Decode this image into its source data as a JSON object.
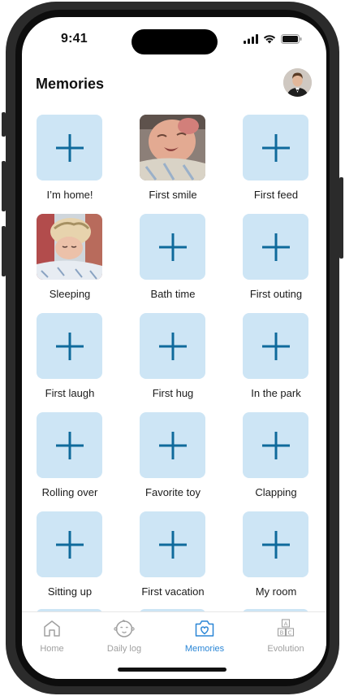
{
  "status": {
    "time": "9:41"
  },
  "header": {
    "title": "Memories"
  },
  "memories": [
    {
      "label": "I’m home!",
      "has_photo": false
    },
    {
      "label": "First smile",
      "has_photo": true
    },
    {
      "label": "First feed",
      "has_photo": false
    },
    {
      "label": "Sleeping",
      "has_photo": true
    },
    {
      "label": "Bath time",
      "has_photo": false
    },
    {
      "label": "First outing",
      "has_photo": false
    },
    {
      "label": "First laugh",
      "has_photo": false
    },
    {
      "label": "First hug",
      "has_photo": false
    },
    {
      "label": "In the park",
      "has_photo": false
    },
    {
      "label": "Rolling over",
      "has_photo": false
    },
    {
      "label": "Favorite toy",
      "has_photo": false
    },
    {
      "label": "Clapping",
      "has_photo": false
    },
    {
      "label": "Sitting up",
      "has_photo": false
    },
    {
      "label": "First vacation",
      "has_photo": false
    },
    {
      "label": "My room",
      "has_photo": false
    }
  ],
  "tabs": [
    {
      "label": "Home",
      "icon": "house-icon",
      "active": false
    },
    {
      "label": "Daily log",
      "icon": "baby-face-icon",
      "active": false
    },
    {
      "label": "Memories",
      "icon": "photo-heart-icon",
      "active": true
    },
    {
      "label": "Evolution",
      "icon": "abc-blocks-icon",
      "active": false
    }
  ],
  "colors": {
    "tile_bg": "#cde5f5",
    "plus": "#0f6a9c",
    "active_tab": "#2a86d6",
    "inactive_tab": "#a0a0a0"
  }
}
